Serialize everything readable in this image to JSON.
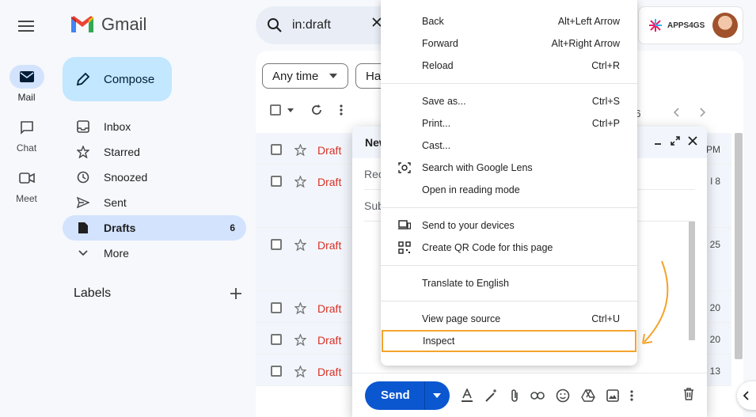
{
  "app": {
    "name": "Gmail"
  },
  "search": {
    "query": "in:draft"
  },
  "account": {
    "brand": "APPS4GS"
  },
  "rail": {
    "items": [
      {
        "label": "Mail"
      },
      {
        "label": "Chat"
      },
      {
        "label": "Meet"
      }
    ]
  },
  "compose_button": {
    "label": "Compose"
  },
  "nav": {
    "items": [
      {
        "label": "Inbox",
        "icon": "inbox-icon"
      },
      {
        "label": "Starred",
        "icon": "star-icon"
      },
      {
        "label": "Snoozed",
        "icon": "clock-icon"
      },
      {
        "label": "Sent",
        "icon": "send-icon"
      },
      {
        "label": "Drafts",
        "icon": "draft-icon",
        "count": "6"
      },
      {
        "label": "More",
        "icon": "chevron-down-icon"
      }
    ],
    "labels_heading": "Labels"
  },
  "filters": {
    "time": "Any time",
    "has": "Ha"
  },
  "pager": {
    "text": "f 6"
  },
  "rows": [
    {
      "status": "Draft",
      "date": "PM"
    },
    {
      "status": "Draft",
      "date": "l 8"
    },
    {
      "status": "Draft",
      "date": "25"
    },
    {
      "status": "Draft",
      "date": "20"
    },
    {
      "status": "Draft",
      "date": "20"
    },
    {
      "status": "Draft",
      "date": "13"
    }
  ],
  "compose_window": {
    "title": "New",
    "recipients_label": "Rec",
    "subject_label": "Sub",
    "send_label": "Send"
  },
  "context_menu": {
    "groups": [
      [
        {
          "label": "Back",
          "shortcut": "Alt+Left Arrow"
        },
        {
          "label": "Forward",
          "shortcut": "Alt+Right Arrow"
        },
        {
          "label": "Reload",
          "shortcut": "Ctrl+R"
        }
      ],
      [
        {
          "label": "Save as...",
          "shortcut": "Ctrl+S"
        },
        {
          "label": "Print...",
          "shortcut": "Ctrl+P"
        },
        {
          "label": "Cast...",
          "shortcut": ""
        },
        {
          "label": "Search with Google Lens",
          "shortcut": "",
          "icon": "lens-icon"
        },
        {
          "label": "Open in reading mode",
          "shortcut": ""
        }
      ],
      [
        {
          "label": "Send to your devices",
          "shortcut": "",
          "icon": "devices-icon"
        },
        {
          "label": "Create QR Code for this page",
          "shortcut": "",
          "icon": "qr-code-icon"
        }
      ],
      [
        {
          "label": "Translate to English",
          "shortcut": ""
        }
      ],
      [
        {
          "label": "View page source",
          "shortcut": "Ctrl+U"
        },
        {
          "label": "Inspect",
          "shortcut": "",
          "highlighted": true
        }
      ]
    ]
  },
  "colors": {
    "accent": "#0b57d0",
    "draft": "#d93025",
    "highlight": "#f4a42c"
  }
}
